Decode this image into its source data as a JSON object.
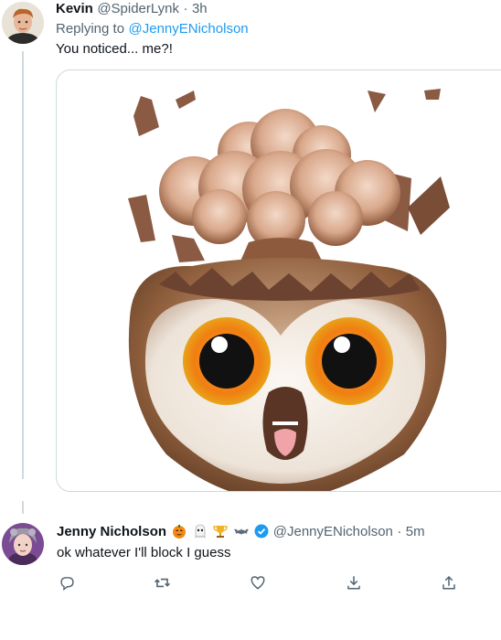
{
  "tweet1": {
    "author_name": "Kevin",
    "handle": "@SpiderLynk",
    "separator": "·",
    "time": "3h",
    "replying_prefix": "Replying to",
    "replying_handle": "@JennyENicholson",
    "text": "You noticed... me?!",
    "media_icon": "exploding-head-owl-emoji"
  },
  "tweet2": {
    "author_name": "Jenny Nicholson",
    "name_emojis": [
      "jack-o-lantern-icon",
      "ghost-icon",
      "trophy-icon",
      "bat-icon"
    ],
    "verified_icon": "verified-badge-icon",
    "handle": "@JennyENicholson",
    "separator": "·",
    "time": "5m",
    "text": "ok whatever I'll block I guess",
    "actions": [
      "reply-icon",
      "retweet-icon",
      "like-icon",
      "share-down-icon",
      "share-up-icon"
    ]
  },
  "colors": {
    "accent": "#1d9bf0",
    "muted_text": "#536471",
    "border": "#cfd9de"
  }
}
